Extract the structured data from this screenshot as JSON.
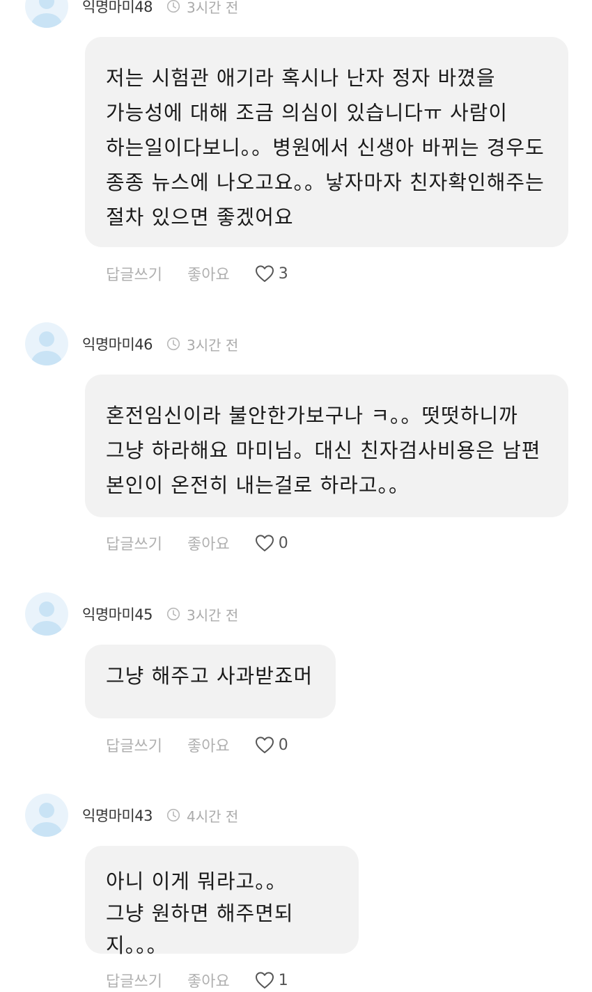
{
  "comments": [
    {
      "nickname": "익명마미48",
      "time": "3시간 전",
      "text": "저는 시험관 애기라 혹시나 난자 정자 바꼈을\n가능성에 대해 조금 의심이 있습니다ㅠ 사람이\n하는일이다보니。。병원에서 신생아 바뀌는 경우도\n종종 뉴스에 나오고요。。낳자마자 친자확인해주는\n절차 있으면 좋겠어요",
      "reply_label": "답글쓰기",
      "like_label": "좋아요",
      "like_count": "3"
    },
    {
      "nickname": "익명마미46",
      "time": "3시간 전",
      "text": "혼전임신이라 불안한가보구나 ㅋ。。떳떳하니까\n그냥 하라해요 마미님。대신 친자검사비용은 남편\n본인이 온전히 내는걸로 하라고。。",
      "reply_label": "답글쓰기",
      "like_label": "좋아요",
      "like_count": "0"
    },
    {
      "nickname": "익명마미45",
      "time": "3시간 전",
      "text": "그냥 해주고 사과받죠머",
      "reply_label": "답글쓰기",
      "like_label": "좋아요",
      "like_count": "0"
    },
    {
      "nickname": "익명마미43",
      "time": "4시간 전",
      "text": "아니 이게 뭐라고。。\n그냥 원하면 해주면되지。。。",
      "reply_label": "답글쓰기",
      "like_label": "좋아요",
      "like_count": "1"
    }
  ],
  "icons": {
    "avatar": "default-user-icon",
    "time": "clock-icon",
    "like": "heart-outline-icon"
  },
  "colors": {
    "bubble_bg": "#f2f2f2",
    "avatar_bg": "#e9f3fb",
    "avatar_fg": "#c9e3f5",
    "muted_text": "#b0b0b0"
  }
}
